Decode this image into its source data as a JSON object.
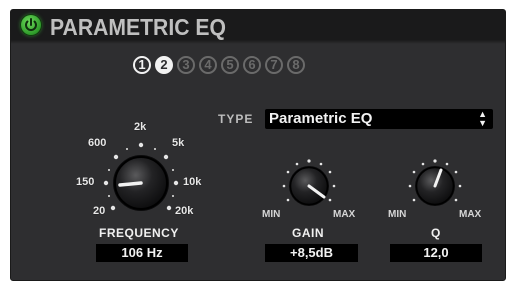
{
  "header": {
    "title": "PARAMETRIC EQ",
    "power_on": true
  },
  "bands": [
    "1",
    "2",
    "3",
    "4",
    "5",
    "6",
    "7",
    "8"
  ],
  "type": {
    "label": "TYPE",
    "value": "Parametric EQ"
  },
  "frequency": {
    "name": "FREQUENCY",
    "readout": "106 Hz",
    "scale_labels": {
      "f20": "20",
      "f150": "150",
      "f600": "600",
      "f2k": "2k",
      "f5k": "5k",
      "f10k": "10k",
      "f20k": "20k"
    }
  },
  "gain": {
    "name": "GAIN",
    "readout": "+8,5dB",
    "min_label": "MIN",
    "max_label": "MAX"
  },
  "q": {
    "name": "Q",
    "readout": "12,0",
    "min_label": "MIN",
    "max_label": "MAX"
  },
  "colors": {
    "panel": "#2e2e30",
    "header": "#1a1a1b",
    "power": "#3ea63a",
    "readout_bg": "#000000",
    "text": "#f2f2f2"
  }
}
